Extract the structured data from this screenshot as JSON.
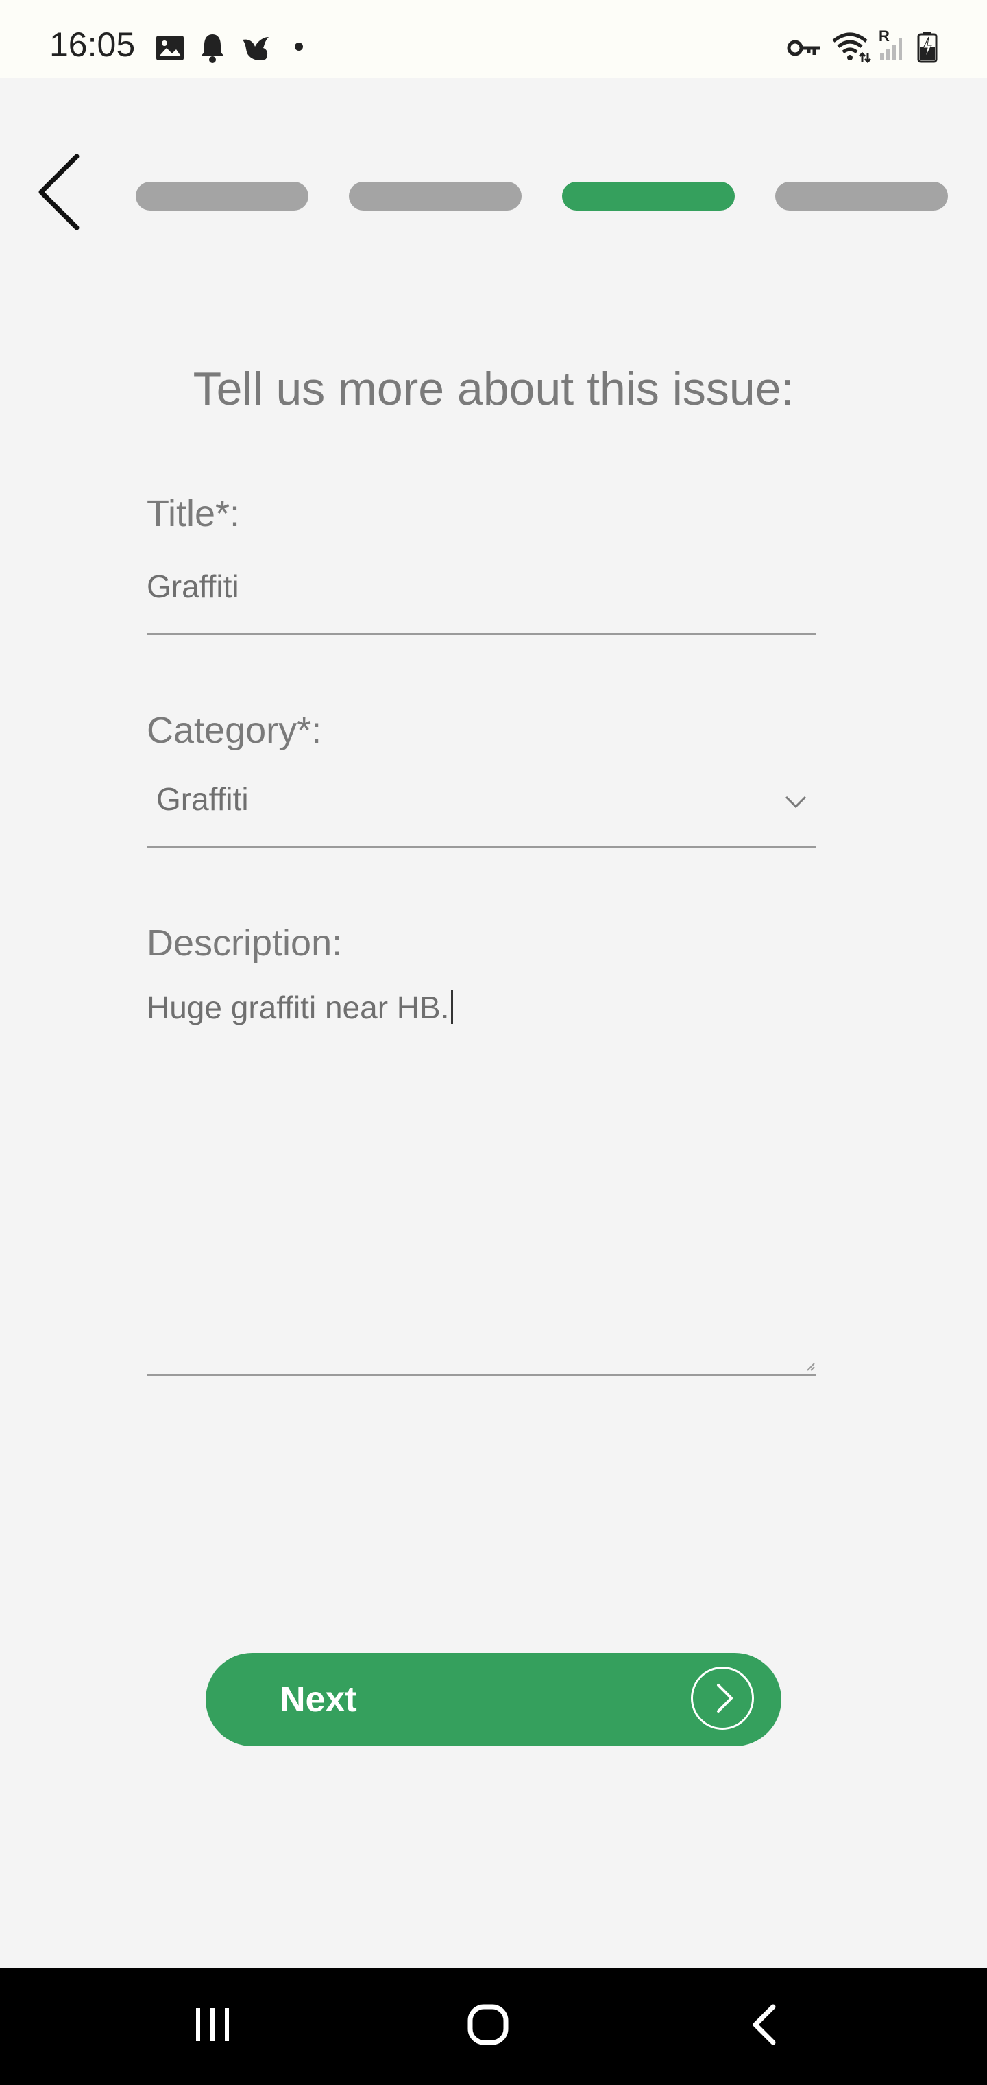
{
  "status_bar": {
    "time": "16:05",
    "left_icons": [
      "image-icon",
      "bell-icon",
      "bird-icon",
      "dot-icon"
    ],
    "right_icons": [
      "key-icon",
      "wifi-icon",
      "signal-icon",
      "battery-icon"
    ],
    "roaming_indicator": "R"
  },
  "header": {
    "back_icon": "chevron-left-icon",
    "steps_total": 4,
    "active_step": 3
  },
  "form": {
    "heading": "Tell us more about this issue:",
    "title_label": "Title*:",
    "title_value": "Graffiti",
    "category_label": "Category*:",
    "category_value": "Graffiti",
    "description_label": "Description:",
    "description_value": "Huge graffiti near HB."
  },
  "actions": {
    "next_label": "Next"
  },
  "colors": {
    "accent": "#35a05d",
    "step_inactive": "#a4a4a4",
    "background": "#f4f4f4",
    "text_muted": "#7a7a7a"
  },
  "nav_bar": {
    "icons": [
      "recent-apps-icon",
      "home-icon",
      "back-icon"
    ]
  }
}
